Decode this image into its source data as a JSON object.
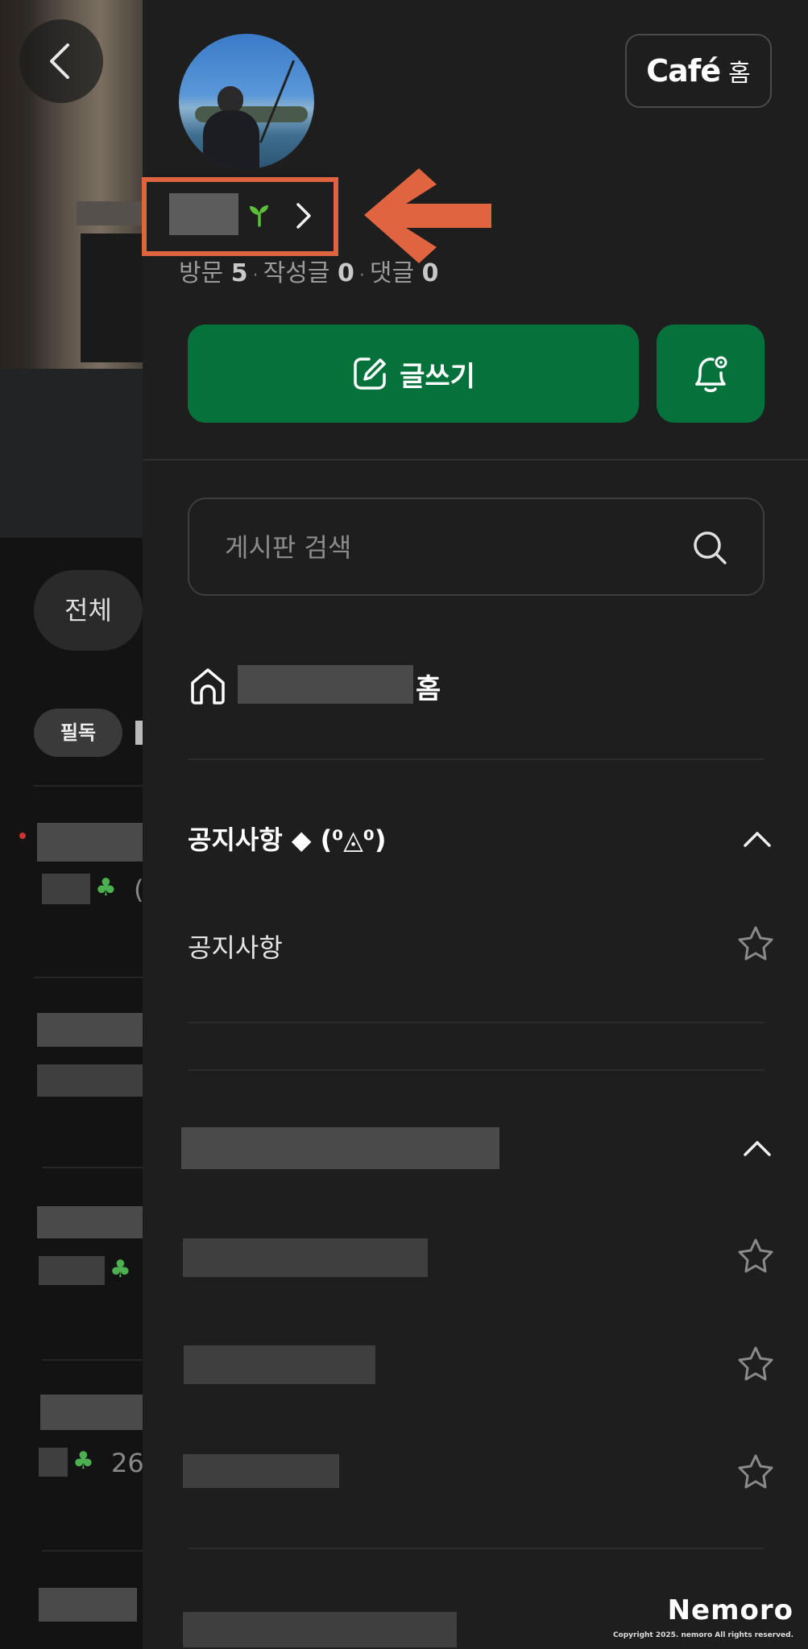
{
  "background_page": {
    "chip_all": "전체",
    "chip_must_read": "필독",
    "counts": [
      "(",
      "26"
    ]
  },
  "drawer": {
    "cafe_home_button": {
      "logo": "Café",
      "suffix": "홈"
    },
    "stats": {
      "visits_label": "방문",
      "visits_value": "5",
      "posts_label": "작성글",
      "posts_value": "0",
      "comments_label": "댓글",
      "comments_value": "0"
    },
    "write_button_label": "글쓰기",
    "search": {
      "placeholder": "게시판 검색",
      "value": ""
    },
    "cafe_home_suffix": "홈",
    "notice_group": {
      "title": "공지사항 ◆ (⁰◬⁰)",
      "items": [
        "공지사항"
      ]
    }
  },
  "watermark": {
    "brand": "Nemoro",
    "copyright": "Copyright 2025. nemoro All rights reserved."
  },
  "colors": {
    "accent_green": "#04723a",
    "highlight_orange": "#e0643f",
    "drawer_bg": "#1e1e1e"
  },
  "icons": [
    "back-icon",
    "sprout-icon",
    "chevron-right-icon",
    "edit-icon",
    "bell-gear-icon",
    "search-icon",
    "home-icon",
    "chevron-up-icon",
    "star-icon"
  ]
}
